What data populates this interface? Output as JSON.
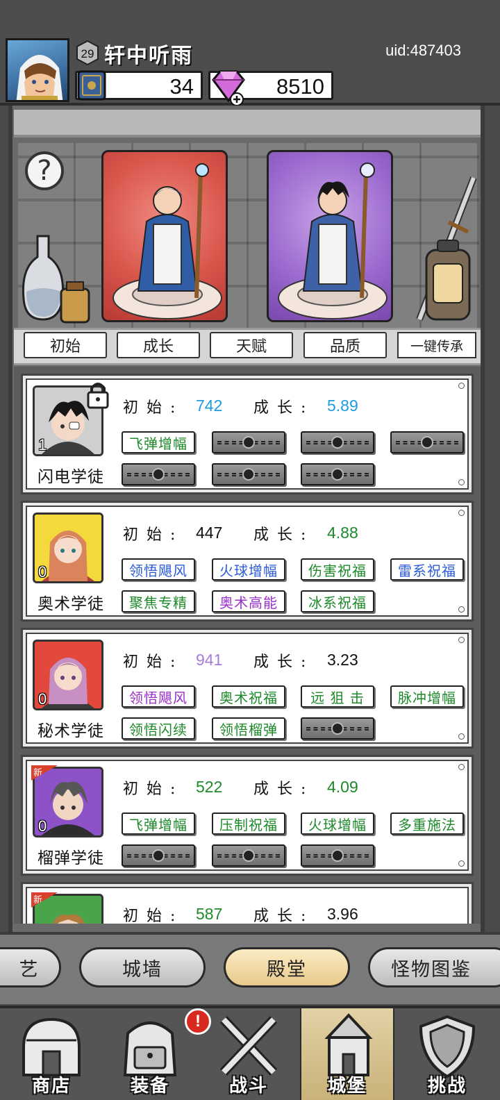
{
  "player": {
    "level": "29",
    "name": "轩中听雨",
    "uid": "uid:487403",
    "books": "34",
    "gems": "8510"
  },
  "filters": {
    "initial": "初始",
    "growth": "成长",
    "talent": "天赋",
    "quality": "品质",
    "inherit": "一键传承"
  },
  "stat_labels": {
    "initial": "初始:",
    "growth": "成长:"
  },
  "heroes": [
    {
      "name": "闪电学徒",
      "count": "1",
      "initial": "742",
      "growth": "5.89",
      "initial_color": "#1e9be0",
      "growth_color": "#1e9be0",
      "locked": true,
      "skills_row1": [
        {
          "label": "飞弹增幅",
          "color": "#1d8a2a"
        }
      ],
      "skills_row2": []
    },
    {
      "name": "奥术学徒",
      "count": "0",
      "initial": "447",
      "growth": "4.88",
      "initial_color": "#111111",
      "growth_color": "#1d8a2a",
      "skills_row1": [
        {
          "label": "领悟飓风",
          "color": "#2b5bd8"
        },
        {
          "label": "火球增幅",
          "color": "#2b5bd8"
        },
        {
          "label": "伤害祝福",
          "color": "#1d8a2a"
        },
        {
          "label": "雷系祝福",
          "color": "#2b5bd8"
        }
      ],
      "skills_row2": [
        {
          "label": "聚焦专精",
          "color": "#1d8a2a"
        },
        {
          "label": "奥术高能",
          "color": "#9b2fc9"
        },
        {
          "label": "冰系祝福",
          "color": "#1d8a2a"
        }
      ]
    },
    {
      "name": "秘术学徒",
      "count": "0",
      "initial": "941",
      "growth": "3.23",
      "initial_color": "#a77bd8",
      "growth_color": "#111111",
      "skills_row1": [
        {
          "label": "领悟飓风",
          "color": "#9b2fc9"
        },
        {
          "label": "奥术祝福",
          "color": "#1d8a2a"
        },
        {
          "label": "远 狙 击",
          "color": "#1d8a2a"
        },
        {
          "label": "脉冲增幅",
          "color": "#1d8a2a"
        }
      ],
      "skills_row2": [
        {
          "label": "领悟闪续",
          "color": "#1d8a2a"
        },
        {
          "label": "领悟榴弹",
          "color": "#1d8a2a"
        }
      ]
    },
    {
      "name": "榴弹学徒",
      "count": "0",
      "initial": "522",
      "growth": "4.09",
      "initial_color": "#1d8a2a",
      "growth_color": "#1d8a2a",
      "new_tag": "新",
      "skills_row1": [
        {
          "label": "飞弹增幅",
          "color": "#1d8a2a"
        },
        {
          "label": "压制祝福",
          "color": "#1d8a2a"
        },
        {
          "label": "火球增幅",
          "color": "#1d8a2a"
        },
        {
          "label": "多重施法",
          "color": "#1d8a2a"
        }
      ],
      "skills_row2": []
    },
    {
      "name": "",
      "count": "",
      "initial": "587",
      "growth": "3.96",
      "initial_color": "#1d8a2a",
      "growth_color": "#111111",
      "new_tag": "新"
    }
  ],
  "section_tabs": [
    "艺",
    "城墙",
    "殿堂",
    "怪物图鉴"
  ],
  "nav": {
    "shop": "商店",
    "equip": "装备",
    "battle": "战斗",
    "castle": "城堡",
    "challenge": "挑战",
    "alert": "!"
  }
}
